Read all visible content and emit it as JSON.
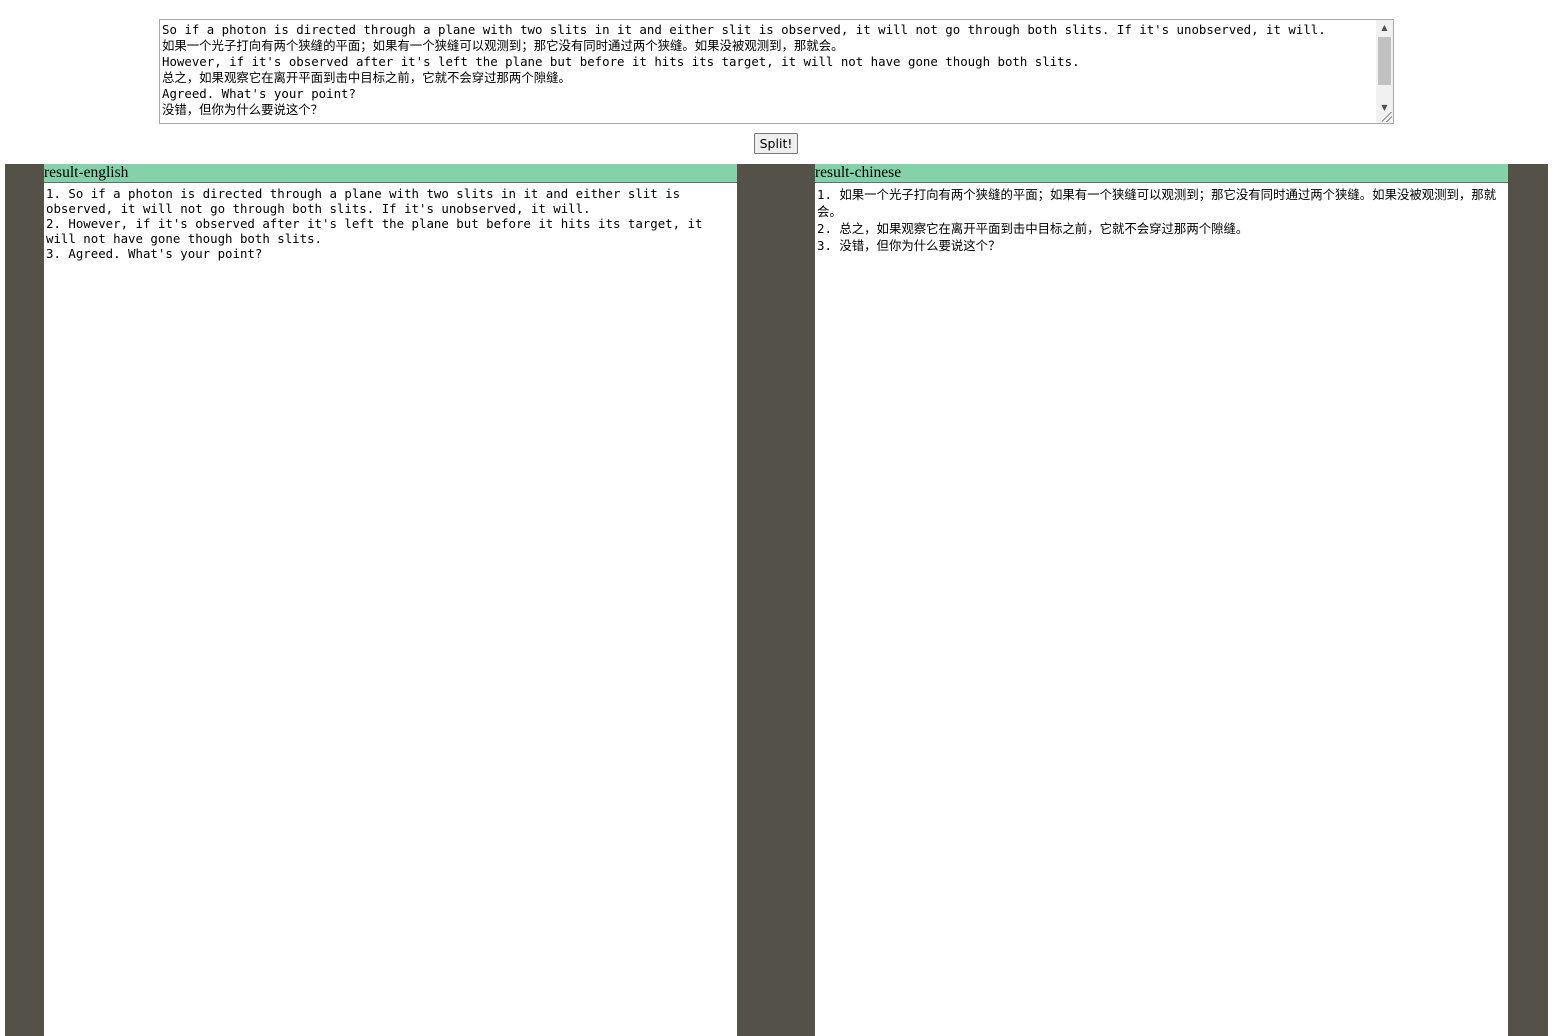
{
  "input": {
    "lines": [
      "So if a photon is directed through a plane with two slits in it and either slit is observed, it will not go through both slits. If it's unobserved, it will.",
      "如果一个光子打向有两个狭缝的平面；如果有一个狭缝可以观测到；那它没有同时通过两个狭缝。如果没被观测到，那就会。",
      "However, if it's observed after it's left the plane but before it hits its target, it will not have gone though both slits.",
      "总之，如果观察它在离开平面到击中目标之前，它就不会穿过那两个隙缝。",
      "Agreed. What's your point?",
      "没错，但你为什么要说这个？"
    ]
  },
  "split_button": {
    "label": "Split!"
  },
  "result_english": {
    "header": "result-english",
    "lines": [
      "1. So if a photon is directed through a plane with two slits in it and either slit is observed, it will not go through both slits. If it's unobserved, it will.",
      "2. However, if it's observed after it's left the plane but before it hits its target, it will not have gone though both slits.",
      "3. Agreed. What's your point?"
    ]
  },
  "result_chinese": {
    "header": "result-chinese",
    "lines": [
      "1. 如果一个光子打向有两个狭缝的平面；如果有一个狭缝可以观测到；那它没有同时通过两个狭缝。如果没被观测到，那就会。",
      "2. 总之，如果观察它在离开平面到击中目标之前，它就不会穿过那两个隙缝。",
      "3. 没错，但你为什么要说这个？"
    ]
  },
  "colors": {
    "header_bg": "#85d1aa",
    "background_panel": "#545149"
  },
  "icons": [
    "scroll-up-arrow-icon",
    "scroll-down-arrow-icon",
    "resize-grip-icon"
  ]
}
